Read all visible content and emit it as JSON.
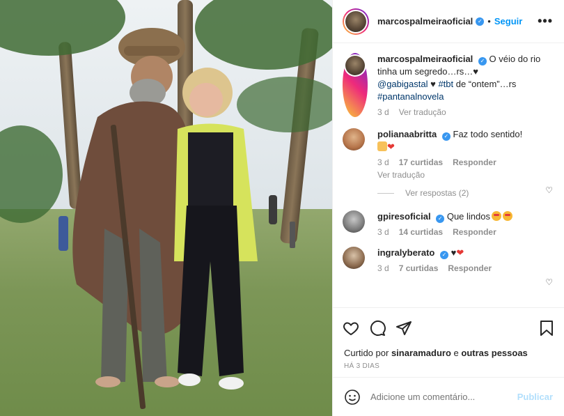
{
  "post": {
    "author": "marcospalmeiraoficial",
    "follow_label": "Seguir",
    "more_label": "•••",
    "caption": {
      "username": "marcospalmeiraoficial",
      "text_1": "O véio do rio tinha um segredo…rs…",
      "heart": "♥",
      "mention": "@gabigastal",
      "text_2": "♥",
      "tag_1": "#tbt",
      "text_3": " de “ontem”…rs",
      "tag_2": "#pantanalnovela",
      "time": "3 d",
      "translate": "Ver tradução"
    },
    "comments": [
      {
        "username": "polianaabritta",
        "text": "Faz todo sentido!",
        "time": "3 d",
        "likes": "17 curtidas",
        "reply": "Responder",
        "translate": "Ver tradução",
        "view_replies": "Ver respostas (2)"
      },
      {
        "username": "gpiresoficial",
        "text": "Que lindos",
        "time": "3 d",
        "likes": "14 curtidas",
        "reply": "Responder"
      },
      {
        "username": "ingralyberato",
        "text": "♥",
        "time": "3 d",
        "likes": "7 curtidas",
        "reply": "Responder"
      }
    ],
    "liked_by": {
      "prefix": "Curtido por",
      "user": "sinaramaduro",
      "middle": "e",
      "others": "outras pessoas"
    },
    "date": "HÁ 3 DIAS",
    "comment_placeholder": "Adicione um comentário...",
    "publish_label": "Publicar"
  },
  "colors": {
    "link": "#00376b",
    "follow": "#0095f6",
    "verified": "#3897f0",
    "muted": "#8e8e8e",
    "publish_disabled": "#b2dffc"
  },
  "icons": [
    "verified-icon",
    "more-icon",
    "heart-icon",
    "comment-icon",
    "share-icon",
    "save-icon",
    "emoji-icon"
  ]
}
